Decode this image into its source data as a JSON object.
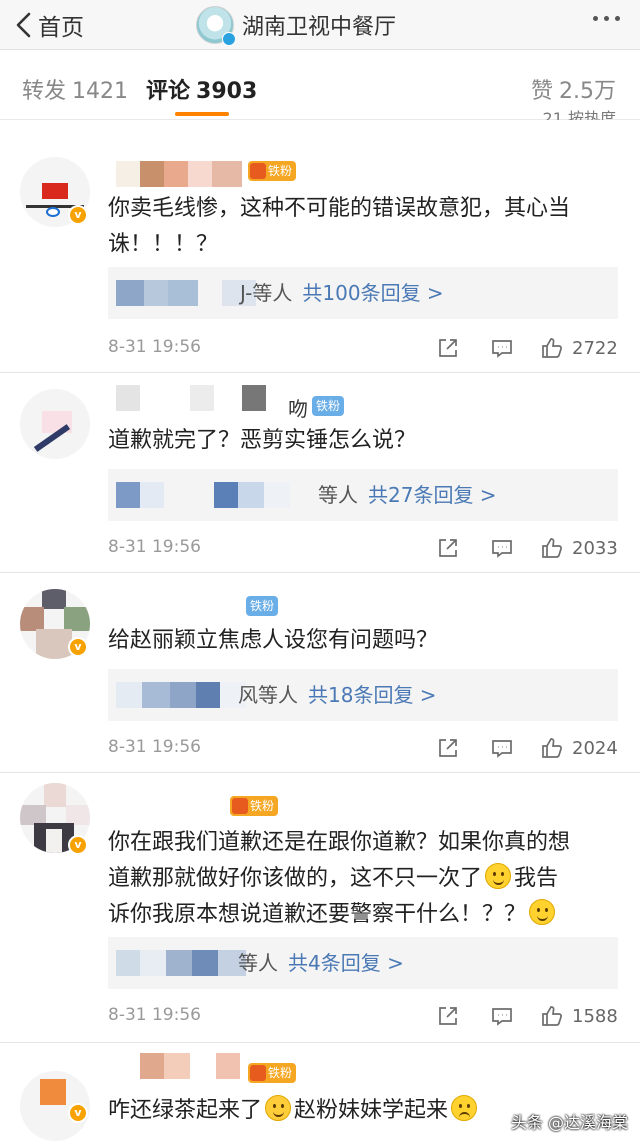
{
  "nav": {
    "back_label": "首页",
    "title": "湖南卫视中餐厅",
    "more_icon": "more-dots-icon"
  },
  "tabs": {
    "forward_label": "转发",
    "forward_count": "1421",
    "comment_label": "评论",
    "comment_count": "3903",
    "like_label": "赞",
    "like_count": "2.5万",
    "accent_color": "#ff8200"
  },
  "peek_text": "21 按热度",
  "comments": [
    {
      "name_tail": "",
      "fan_badge": "铁粉",
      "text": "你卖毛线惨，这种不可能的错误故意犯，其心当诛！！！？",
      "reply_names_tail": "J-等人",
      "reply_count_text": "共100条回复 >",
      "time": "8-31 19:56",
      "likes": "2722"
    },
    {
      "name_tail": "吻",
      "fan_badge": "铁粉",
      "text": "道歉就完了？恶剪实锤怎么说？",
      "reply_names_tail": "等人",
      "reply_count_text": "共27条回复 >",
      "time": "8-31 19:56",
      "likes": "2033"
    },
    {
      "name_tail": "",
      "fan_badge": "铁粉",
      "text": "给赵丽颖立焦虑人设您有问题吗？",
      "reply_names_tail": "风等人",
      "reply_count_text": "共18条回复 >",
      "time": "8-31 19:56",
      "likes": "2024"
    },
    {
      "name_tail": "",
      "fan_badge": "铁粉",
      "text_line1": "你在跟我们道歉还是在跟你道歉？如果你真的想",
      "text_line2": "道歉那就做好你该做的，这不只一次了",
      "text_line2b": "我告",
      "text_line3": "诉你我原本想说道歉还要警察干什么！？？",
      "reply_names_tail": "等人",
      "reply_count_text": "共4条回复 >",
      "time": "8-31 19:56",
      "likes": "1588"
    },
    {
      "name_tail": "",
      "fan_badge": "铁粉",
      "text_a": "咋还绿茶起来了",
      "text_b": "赵粉妹妹学起来"
    }
  ],
  "watermark": "头条 @达溪海棠"
}
